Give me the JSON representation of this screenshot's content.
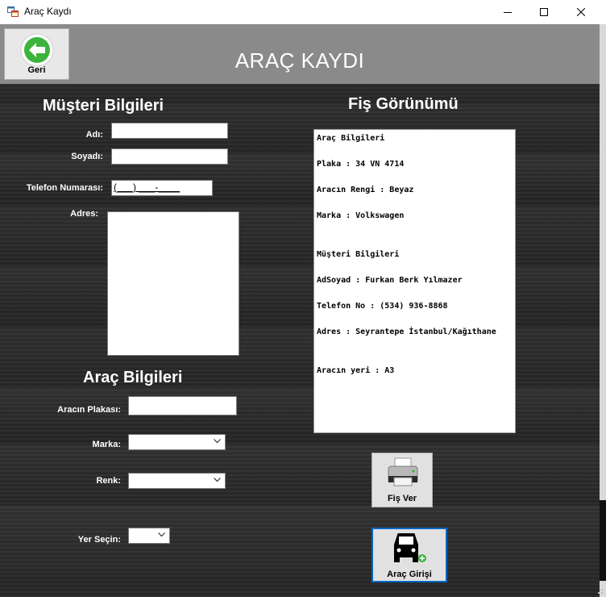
{
  "window": {
    "title": "Araç Kaydı",
    "minimize_icon": "minimize-icon",
    "maximize_icon": "maximize-icon",
    "close_icon": "close-icon"
  },
  "header": {
    "title": "ARAÇ KAYDI",
    "back_button": {
      "label": "Geri",
      "icon": "back-arrow-icon"
    }
  },
  "customer": {
    "section_title": "Müşteri Bilgileri",
    "first_name_label": "Adı:",
    "first_name_value": "",
    "last_name_label": "Soyadı:",
    "last_name_value": "",
    "phone_label": "Telefon Numarası:",
    "phone_mask": "(___) ___-____",
    "address_label": "Adres:",
    "address_value": ""
  },
  "vehicle": {
    "section_title": "Araç Bilgileri",
    "plate_label": "Aracın Plakası:",
    "plate_value": "",
    "brand_label": "Marka:",
    "brand_value": "",
    "color_label": "Renk:",
    "color_value": "",
    "spot_label": "Yer Seçin:",
    "spot_value": ""
  },
  "receipt": {
    "section_title": "Fiş Görünümü",
    "lines": [
      "Araç Bilgileri",
      "Plaka : 34 VN 4714",
      "Aracın Rengi : Beyaz",
      "Marka : Volkswagen",
      "Müşteri Bilgileri",
      "AdSoyad : Furkan Berk Yılmazer",
      "Telefon No : (534) 936-8868",
      "Adres : Seyrantepe İstanbul/Kağıthane",
      "Aracın yeri : A3"
    ]
  },
  "actions": {
    "print_button": {
      "label": "Fiş Ver",
      "icon": "printer-icon"
    },
    "entry_button": {
      "label": "Araç Girişi",
      "icon": "car-add-icon"
    }
  },
  "colors": {
    "header_bg": "#8a8a8a",
    "accent_border": "#0067c0",
    "back_arrow": "#3cb43c"
  }
}
